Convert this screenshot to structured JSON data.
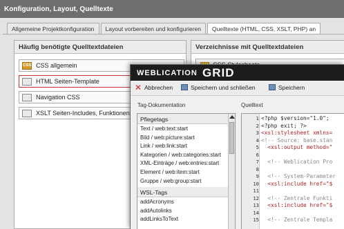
{
  "window_title": "Konfiguration, Layout, Quelltexte",
  "tabs": [
    {
      "label": "Allgemeine Projektkonfiguration"
    },
    {
      "label": "Layout vorbereiten und konfigurieren"
    },
    {
      "label": "Quelltexte (HTML, CSS, XSLT, PHP) an"
    }
  ],
  "left_panel": {
    "title": "Häufig benötigte Quelltextdateien",
    "items": [
      {
        "label": "CSS allgemein",
        "icon": "css-file-icon",
        "icon_text": "CSS"
      },
      {
        "label": "HTML Seiten-Template",
        "icon": "html-file-icon",
        "highlighted": true
      },
      {
        "label": "Navigation CSS",
        "icon": "text-file-icon"
      },
      {
        "label": "XSLT Seiten-Includes, Funktionen",
        "icon": "xslt-file-icon"
      }
    ]
  },
  "right_panel": {
    "title": "Verzeichnisse mit Quelltextdateien",
    "items": [
      {
        "label": "CSS-Stylesheets",
        "icon": "folder-icon"
      }
    ]
  },
  "editor": {
    "brand_left": "WEBLICATION",
    "brand_right": "GRID",
    "toolbar": {
      "cancel": "Abbrechen",
      "save_close": "Speichern und schließen",
      "save": "Speichern"
    },
    "tagdoc_label": "Tag-Dokumentation",
    "source_label": "Quelltext",
    "tag_sections": [
      {
        "title": "Pflegetags",
        "items": [
          "Text / web:text:start",
          "Bild / web:picture:start",
          "Link / web:link:start",
          "Kategorien / web:categories:start",
          "XML-Einträge / web:entries:start",
          "Element / web:item:start",
          "Gruppe / web:group:start"
        ]
      },
      {
        "title": "WSL-Tags",
        "items": [
          "addAcronyms",
          "addAutolinks",
          "addLinksToText"
        ]
      }
    ],
    "code_lines": [
      {
        "n": "1",
        "text": "<?php $version=\"1.0\";",
        "style": "plain"
      },
      {
        "n": "2",
        "text": "<?php exit; ?>",
        "style": "plain"
      },
      {
        "n": "3",
        "text": "<xsl:stylesheet xmlns=",
        "style": "red"
      },
      {
        "n": "4",
        "text": "<!-- Source: base.stan",
        "style": "gray"
      },
      {
        "n": "5",
        "text": "  <xsl:output method=\"",
        "style": "red"
      },
      {
        "n": "6",
        "text": "",
        "style": "plain"
      },
      {
        "n": "7",
        "text": "  <!-- Weblication Pro",
        "style": "gray"
      },
      {
        "n": "8",
        "text": "",
        "style": "plain"
      },
      {
        "n": "9",
        "text": "  <!-- System-Parameter",
        "style": "gray"
      },
      {
        "n": "10",
        "text": "  <xsl:include href=\"$",
        "style": "red"
      },
      {
        "n": "11",
        "text": "",
        "style": "plain"
      },
      {
        "n": "12",
        "text": "  <!-- Zentrale Funkti",
        "style": "gray"
      },
      {
        "n": "13",
        "text": "  <xsl:include href=\"$",
        "style": "red"
      },
      {
        "n": "14",
        "text": "",
        "style": "plain"
      },
      {
        "n": "15",
        "text": "  <!-- Zentrale Templa",
        "style": "gray"
      }
    ]
  },
  "colors": {
    "titlebar_bg": "#6e6e6e",
    "editor_header_bg": "#1c1c1c",
    "highlight_border": "#c43232",
    "xml_red": "#b02020"
  }
}
